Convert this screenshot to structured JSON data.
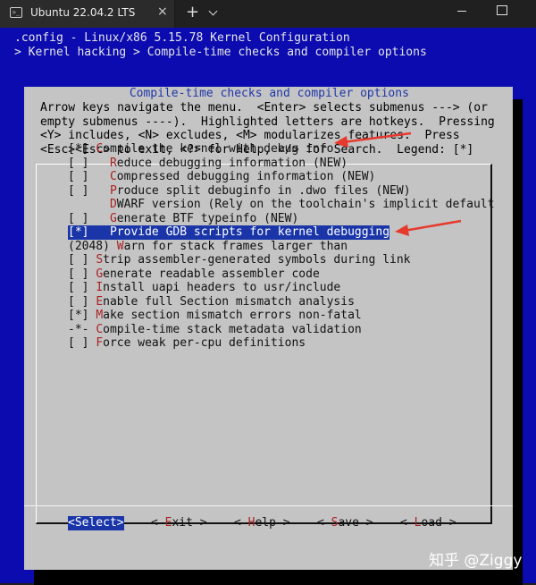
{
  "window": {
    "tab_title": "Ubuntu 22.04.2 LTS",
    "tab_icon_text": ">_",
    "new_tab_label": "+",
    "close_label": "×"
  },
  "header": {
    "line1": ".config - Linux/x86 5.15.78 Kernel Configuration",
    "line2": "> Kernel hacking > Compile-time checks and compiler options"
  },
  "dialog": {
    "title": " Compile-time checks and compiler options ",
    "help": [
      "Arrow keys navigate the menu.  <Enter> selects submenus ---> (or",
      "empty submenus ----).  Highlighted letters are hotkeys.  Pressing",
      "<Y> includes, <N> excludes, <M> modularizes features.  Press",
      "<Esc><Esc> to exit, <?> for Help, </> for Search.  Legend: [*]"
    ]
  },
  "menu_items": [
    {
      "prefix": "[*] ",
      "hotkey": "C",
      "rest": "ompile the kernel with debug info"
    },
    {
      "prefix": "[ ]   ",
      "hotkey": "R",
      "rest": "educe debugging information (NEW)"
    },
    {
      "prefix": "[ ]   ",
      "hotkey": "C",
      "rest": "ompressed debugging information (NEW)"
    },
    {
      "prefix": "[ ]   ",
      "hotkey": "P",
      "rest": "roduce split debuginfo in .dwo files (NEW)"
    },
    {
      "prefix": "      ",
      "hotkey": "D",
      "rest": "WARF version (Rely on the toolchain's implicit default"
    },
    {
      "prefix": "[ ]   ",
      "hotkey": "G",
      "rest": "enerate BTF typeinfo (NEW)"
    },
    {
      "prefix": "[*]   ",
      "hotkey": "P",
      "rest": "rovide GDB scripts for kernel debugging",
      "selected": true
    },
    {
      "prefix": "(2048) ",
      "hotkey": "W",
      "rest": "arn for stack frames larger than"
    },
    {
      "prefix": "[ ] ",
      "hotkey": "S",
      "rest": "trip assembler-generated symbols during link"
    },
    {
      "prefix": "[ ] ",
      "hotkey": "G",
      "rest": "enerate readable assembler code"
    },
    {
      "prefix": "[ ] ",
      "hotkey": "I",
      "rest": "nstall uapi headers to usr/include"
    },
    {
      "prefix": "[ ] ",
      "hotkey": "E",
      "rest": "nable full Section mismatch analysis"
    },
    {
      "prefix": "[*] ",
      "hotkey": "M",
      "rest": "ake section mismatch errors non-fatal"
    },
    {
      "prefix": "-*- ",
      "hotkey": "C",
      "rest": "ompile-time stack metadata validation"
    },
    {
      "prefix": "[ ] ",
      "hotkey": "F",
      "rest": "orce weak per-cpu definitions"
    }
  ],
  "buttons": {
    "select": {
      "pre": "<",
      "hotkey": "S",
      "post": "elect>"
    },
    "exit": {
      "pre": "< ",
      "hotkey": "E",
      "post": "xit >"
    },
    "help": {
      "pre": "< ",
      "hotkey": "H",
      "post": "elp >"
    },
    "save": {
      "pre": "< ",
      "hotkey": "S",
      "post": "ave >"
    },
    "load": {
      "pre": "< ",
      "hotkey": "L",
      "post": "oad >"
    }
  },
  "watermark": "知乎 @Ziggy",
  "colors": {
    "terminal_bg": "#0b0bb0",
    "dialog_bg": "#c4c4c4",
    "selection_bg": "#1935a8",
    "hotkey": "#a82222",
    "annotation_arrow": "#e63a2e"
  }
}
